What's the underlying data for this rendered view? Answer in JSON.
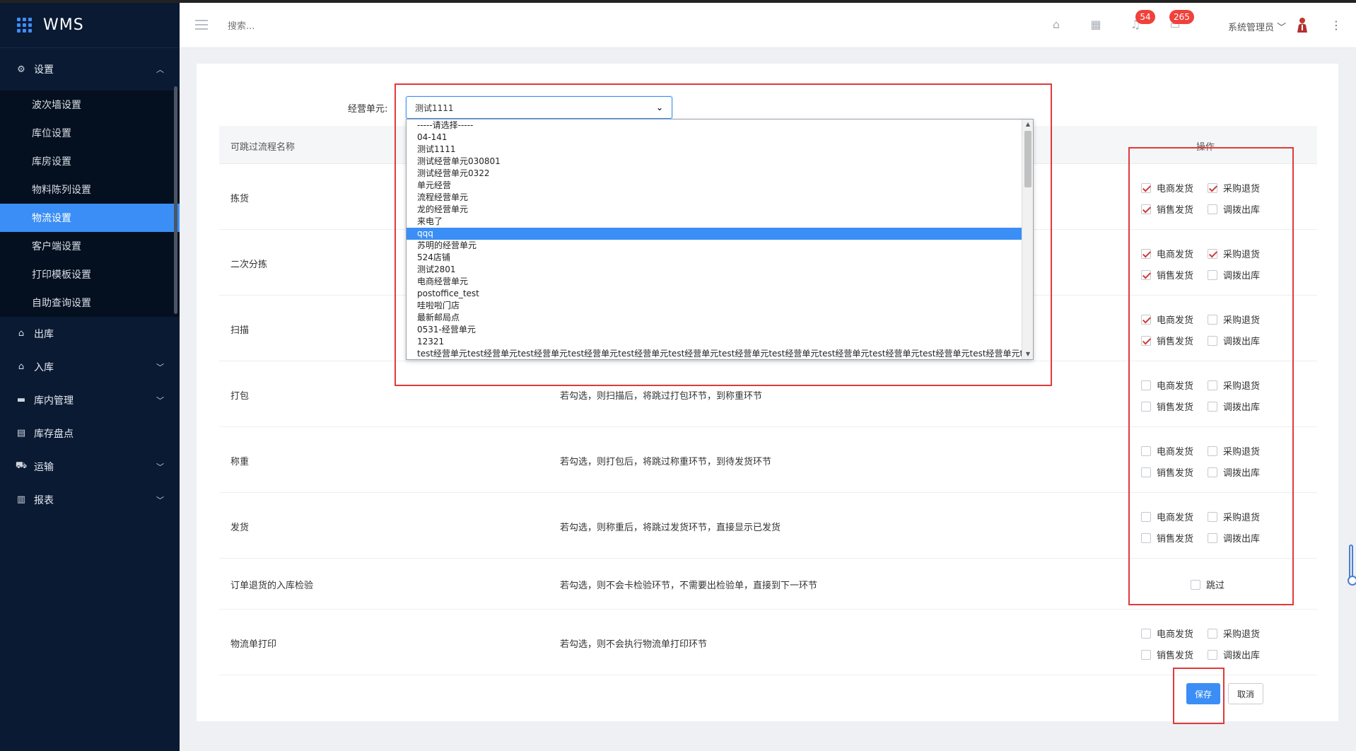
{
  "app": {
    "name": "WMS"
  },
  "sidebar": {
    "settings_group": "设置",
    "settings_items": [
      "波次墙设置",
      "库位设置",
      "库房设置",
      "物料陈列设置",
      "物流设置",
      "客户端设置",
      "打印模板设置",
      "自助查询设置"
    ],
    "active_item": "物流设置",
    "menu": [
      {
        "label": "出库",
        "icon": "outbound-icon",
        "expandable": false
      },
      {
        "label": "入库",
        "icon": "inbound-icon",
        "expandable": true
      },
      {
        "label": "库内管理",
        "icon": "warehouse-icon",
        "expandable": true
      },
      {
        "label": "库存盘点",
        "icon": "inventory-icon",
        "expandable": false
      },
      {
        "label": "运输",
        "icon": "truck-icon",
        "expandable": true
      },
      {
        "label": "报表",
        "icon": "chart-icon",
        "expandable": true
      }
    ]
  },
  "header": {
    "search_placeholder": "搜索...",
    "notification_count": "54",
    "message_count": "265",
    "user_name": "系统管理员"
  },
  "form": {
    "unit_label": "经营单元:",
    "unit_selected": "测试1111",
    "dropdown_options": [
      "-----请选择-----",
      "04-141",
      "测试1111",
      "测试经营单元030801",
      "测试经营单元0322",
      "单元经营",
      "流程经营单元",
      "龙的经营单元",
      "来电了",
      "qqq",
      "苏明的经营单元",
      "524店铺",
      "测试2801",
      "电商经营单元",
      "postoffice_test",
      "哇啦啦门店",
      "最新邮局点",
      "0531-经营单元",
      "12321",
      "test经营单元test经营单元test经营单元test经营单元test经营单元test经营单元test经营单元test经营单元test经营单元test经营单元test经营单元test经营单元test"
    ],
    "highlighted_option": "qqq"
  },
  "table": {
    "col_name": "可跳过流程名称",
    "col_ops": "操作",
    "option_labels": {
      "ecom": "电商发货",
      "purchase_return": "采购退货",
      "sales": "销售发货",
      "transfer": "调拨出库",
      "skip": "跳过"
    },
    "rows": [
      {
        "name": "拣货",
        "desc": "",
        "ecom": true,
        "purchase_return": true,
        "sales": true,
        "transfer": false
      },
      {
        "name": "二次分拣",
        "desc": "",
        "ecom": true,
        "purchase_return": true,
        "sales": true,
        "transfer": false
      },
      {
        "name": "扫描",
        "desc": "",
        "ecom": true,
        "purchase_return": false,
        "sales": true,
        "transfer": false
      },
      {
        "name": "打包",
        "desc": "若勾选，则扫描后，将跳过打包环节，到称重环节",
        "ecom": false,
        "purchase_return": false,
        "sales": false,
        "transfer": false
      },
      {
        "name": "称重",
        "desc": "若勾选，则打包后，将跳过称重环节，到待发货环节",
        "ecom": false,
        "purchase_return": false,
        "sales": false,
        "transfer": false
      },
      {
        "name": "发货",
        "desc": "若勾选，则称重后，将跳过发货环节，直接显示已发货",
        "ecom": false,
        "purchase_return": false,
        "sales": false,
        "transfer": false
      },
      {
        "name": "订单退货的入库检验",
        "desc": "若勾选，则不会卡检验环节，不需要出检验单，直接到下一环节",
        "skip": false
      },
      {
        "name": "物流单打印",
        "desc": "若勾选，则不会执行物流单打印环节",
        "ecom": false,
        "purchase_return": false,
        "sales": false,
        "transfer": false
      }
    ]
  },
  "buttons": {
    "save": "保存",
    "cancel": "取消"
  },
  "colors": {
    "sidebar_bg": "#0b1a33",
    "accent": "#3a8ef5",
    "badge": "#f0413b",
    "annotation_red": "#e03a3a"
  }
}
